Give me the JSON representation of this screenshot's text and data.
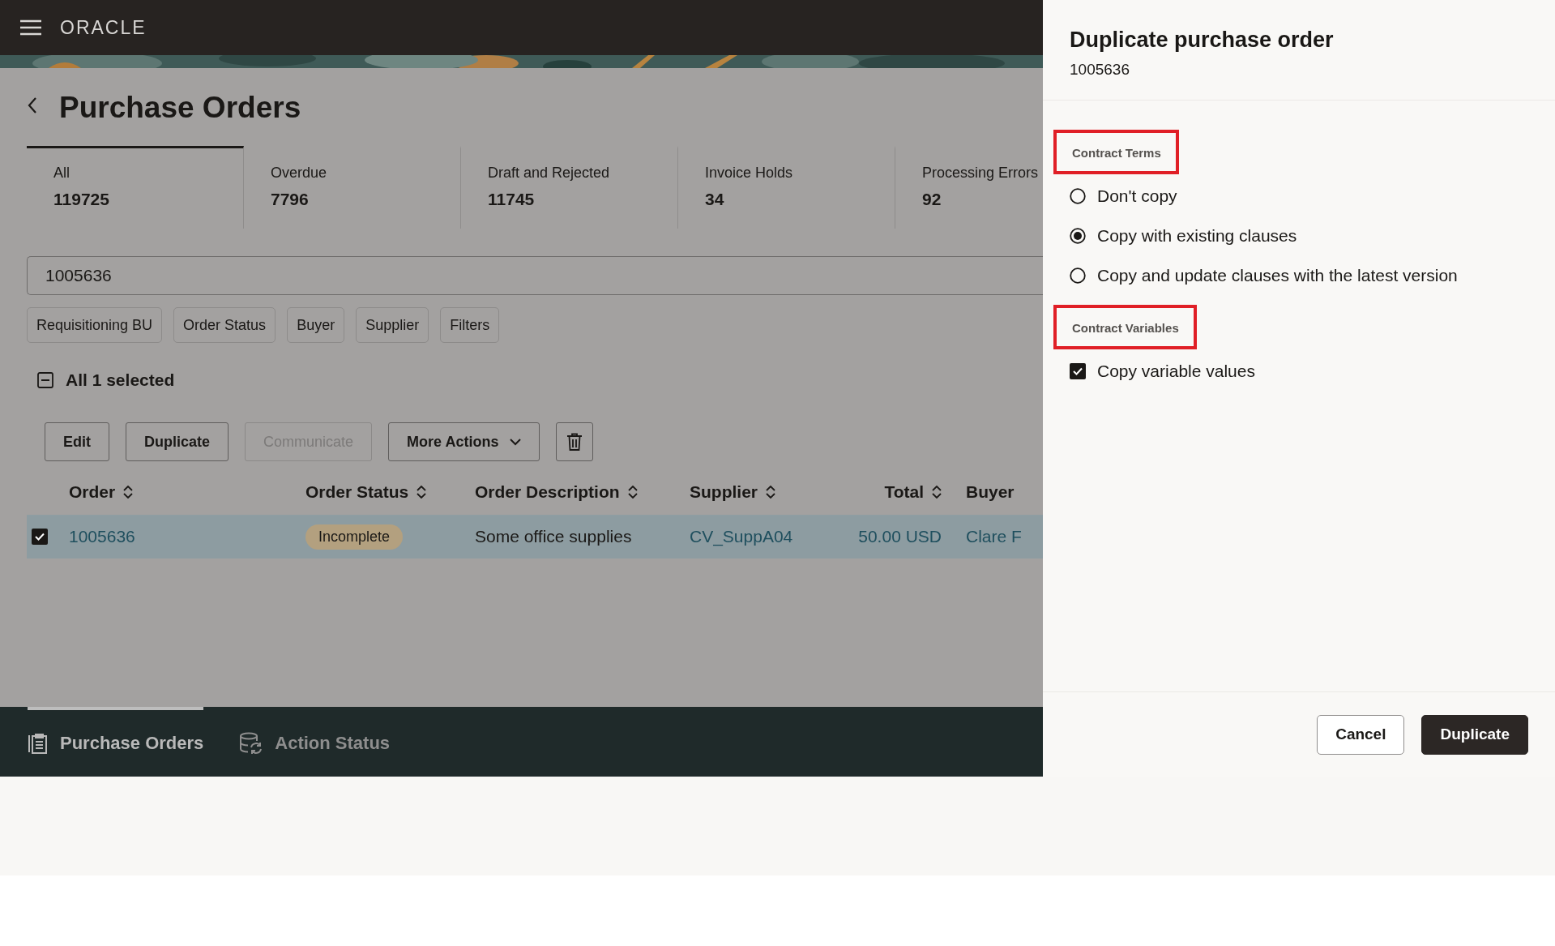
{
  "header": {
    "logo": "ORACLE"
  },
  "page": {
    "title": "Purchase Orders",
    "stats": [
      {
        "label": "All",
        "value": "119725",
        "selected": true
      },
      {
        "label": "Overdue",
        "value": "7796",
        "selected": false
      },
      {
        "label": "Draft and Rejected",
        "value": "11745",
        "selected": false
      },
      {
        "label": "Invoice Holds",
        "value": "34",
        "selected": false
      },
      {
        "label": "Processing Errors",
        "value": "92",
        "selected": false
      }
    ],
    "search": {
      "value": "1005636"
    },
    "filter_chips": [
      "Requisitioning BU",
      "Order Status",
      "Buyer",
      "Supplier",
      "Filters"
    ],
    "selection": {
      "label": "All 1 selected"
    },
    "actions": [
      {
        "kind": "button",
        "label": "Edit",
        "disabled": false
      },
      {
        "kind": "button",
        "label": "Duplicate",
        "disabled": false
      },
      {
        "kind": "button",
        "label": "Communicate",
        "disabled": true
      },
      {
        "kind": "menu",
        "label": "More Actions",
        "disabled": false
      },
      {
        "kind": "delete",
        "disabled": false
      }
    ],
    "table": {
      "columns": [
        {
          "label": "Order",
          "sortable": true
        },
        {
          "label": "Order Status",
          "sortable": true
        },
        {
          "label": "Order Description",
          "sortable": true
        },
        {
          "label": "Supplier",
          "sortable": true
        },
        {
          "label": "Total",
          "sortable": true
        },
        {
          "label": "Buyer",
          "sortable": false
        }
      ],
      "rows": [
        {
          "selected": true,
          "cells": [
            {
              "kind": "link",
              "text": "1005636"
            },
            {
              "kind": "badge",
              "text": "Incomplete"
            },
            {
              "kind": "text",
              "text": "Some office supplies"
            },
            {
              "kind": "link",
              "text": "CV_SuppA04"
            },
            {
              "kind": "link",
              "text": "50.00 USD"
            },
            {
              "kind": "link",
              "text": "Clare F"
            }
          ]
        }
      ]
    }
  },
  "bottom_nav": [
    {
      "kind": "orders",
      "label": "Purchase Orders",
      "selected": true
    },
    {
      "kind": "status",
      "label": "Action Status",
      "selected": false
    }
  ],
  "dialog": {
    "title": "Duplicate purchase order",
    "subtitle": "1005636",
    "sections": [
      {
        "heading": "Contract Terms",
        "highlighted": true,
        "kind": "radio",
        "options": [
          {
            "label": "Don't copy",
            "selected": false
          },
          {
            "label": "Copy with existing clauses",
            "selected": true
          },
          {
            "label": "Copy and update clauses with the latest version",
            "selected": false
          }
        ]
      },
      {
        "heading": "Contract Variables",
        "highlighted": true,
        "kind": "checkbox",
        "options": [
          {
            "label": "Copy variable values",
            "checked": true
          }
        ]
      }
    ],
    "buttons": [
      {
        "kind": "secondary",
        "label": "Cancel"
      },
      {
        "kind": "primary",
        "label": "Duplicate"
      }
    ]
  }
}
